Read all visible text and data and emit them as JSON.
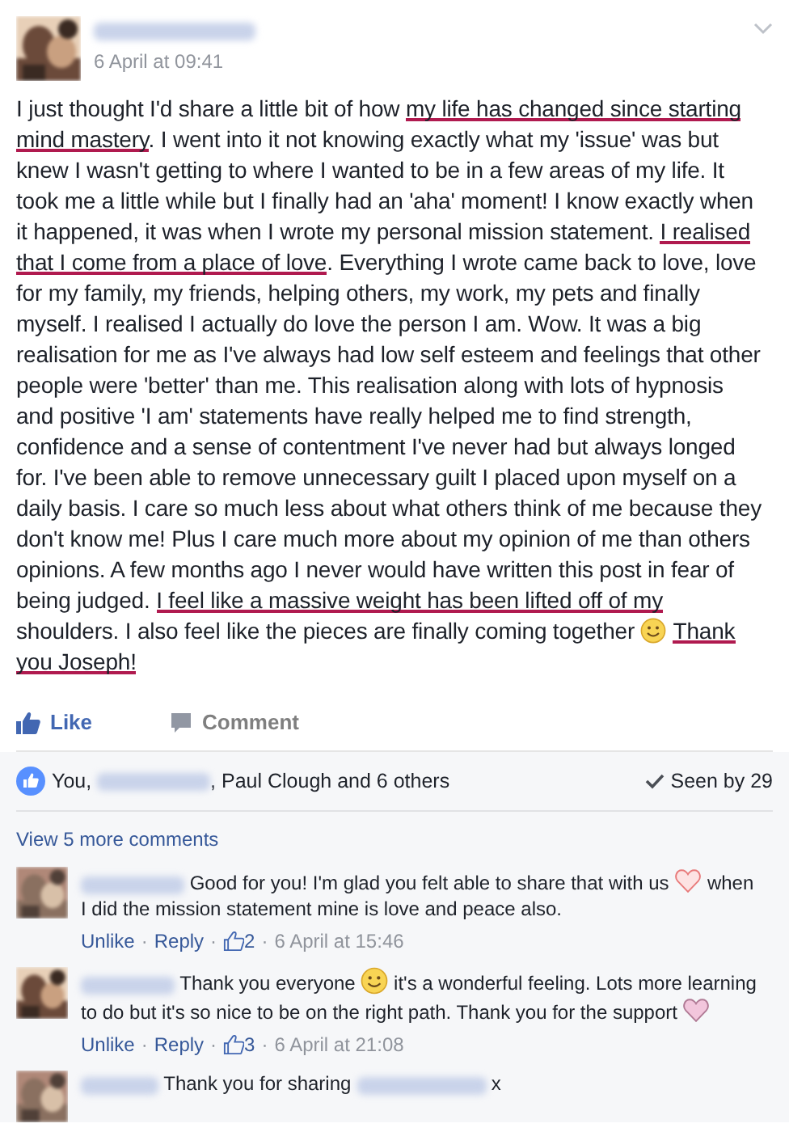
{
  "post": {
    "timestamp": "6 April at 09:41",
    "body": [
      {
        "kind": "text",
        "text": "I just thought I'd share a little bit of how ",
        "underlined": false
      },
      {
        "kind": "text",
        "text": "my life has changed since starting mind mastery",
        "underlined": true
      },
      {
        "kind": "text",
        "text": ". I went into it not knowing exactly what my 'issue' was but knew I wasn't getting to where I wanted to be in a few areas of my life. It took me a little while but I finally had an 'aha' moment! I know exactly when it happened, it was when I wrote my personal mission statement. ",
        "underlined": false
      },
      {
        "kind": "text",
        "text": "I realised that I come from a place of love",
        "underlined": true
      },
      {
        "kind": "text",
        "text": ". Everything I wrote came back to love, love for my family, my friends, helping others, my work, my pets and finally myself. I realised I actually do love the person I am. Wow. It was a big realisation for me as I've always had low self esteem and feelings that other people were 'better' than me. This realisation along with lots of hypnosis and positive 'I am' statements have really helped me to find strength, confidence and a sense of contentment I've never had but always longed for. I've been able to remove unnecessary guilt I placed upon myself on a daily basis. I care so much less about what others think of me because they don't know me! Plus I care much more about my opinion of me than others opinions. A few months ago I never would have written this post in fear of being judged. ",
        "underlined": false
      },
      {
        "kind": "text",
        "text": "I feel like a massive weight has been lifted off of my",
        "underlined": true
      },
      {
        "kind": "text",
        "text": " shoulders. I also feel like the pieces are finally coming together ",
        "underlined": false
      },
      {
        "kind": "smile-emoji"
      },
      {
        "kind": "text",
        "text": "Thank you Joseph!",
        "underlined": true
      }
    ],
    "liked": true
  },
  "actions": [
    {
      "kind": "like",
      "label": "Like"
    },
    {
      "kind": "comment",
      "label": "Comment"
    }
  ],
  "reactions": [
    {
      "kind": "text",
      "text": "You, "
    },
    {
      "kind": "redacted"
    },
    {
      "kind": "text",
      "text": ", Paul Clough and 6 others"
    }
  ],
  "seen": "Seen by 29",
  "view_more": "View 5 more comments",
  "comments": [
    {
      "body": [
        {
          "kind": "redacted"
        },
        {
          "kind": "text",
          "text": " Good for you! I'm glad you felt able to share that with us "
        },
        {
          "kind": "heart-outline-emoji"
        },
        {
          "kind": "text",
          "text": " when I did the mission statement mine is love and peace also."
        }
      ],
      "unlike": "Unlike",
      "reply": "Reply",
      "likes": "2",
      "separator": "·",
      "time": "6 April at 15:46"
    },
    {
      "body": [
        {
          "kind": "redacted"
        },
        {
          "kind": "text",
          "text": " Thank you everyone "
        },
        {
          "kind": "smile-emoji"
        },
        {
          "kind": "text",
          "text": " it's a wonderful feeling. Lots more learning to do but it's so nice to be on the right path. Thank you for the support "
        },
        {
          "kind": "heart-emoji"
        }
      ],
      "unlike": "Unlike",
      "reply": "Reply",
      "likes": "3",
      "separator": "·",
      "time": "6 April at 21:08"
    },
    {
      "body": [
        {
          "kind": "redacted"
        },
        {
          "kind": "text",
          "text": " Thank you for sharing "
        },
        {
          "kind": "redacted"
        },
        {
          "kind": "text",
          "text": " x"
        }
      ]
    }
  ]
}
